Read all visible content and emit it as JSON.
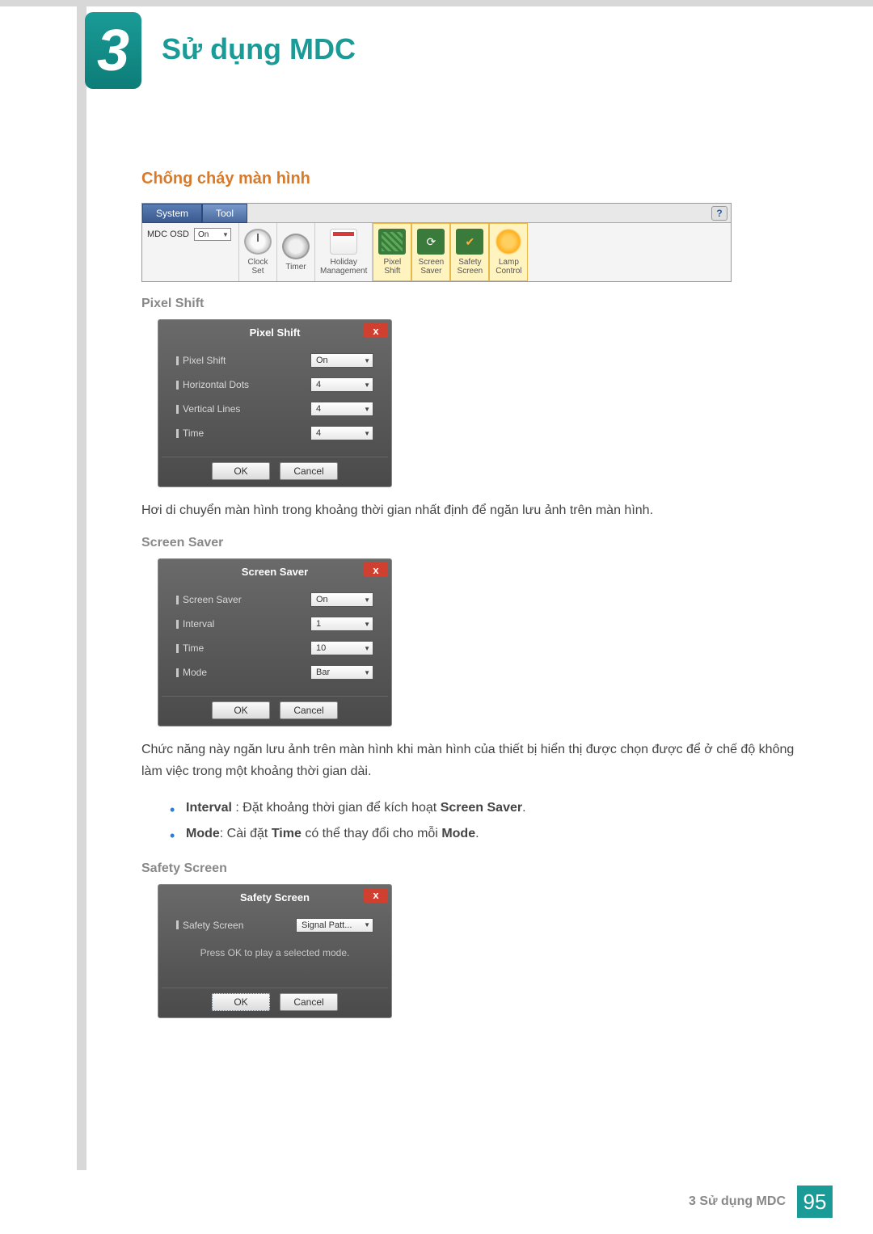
{
  "header": {
    "chapter_number": "3",
    "chapter_title": "Sử dụng MDC"
  },
  "section": {
    "title": "Chống cháy màn hình"
  },
  "toolbar": {
    "tabs": {
      "system": "System",
      "tool": "Tool"
    },
    "mdc_osd_label": "MDC OSD",
    "mdc_osd_value": "On",
    "help": "?",
    "items": {
      "clock_set": "Clock\nSet",
      "timer": "Timer",
      "holiday": "Holiday\nManagement",
      "pixel_shift": "Pixel\nShift",
      "screen_saver": "Screen\nSaver",
      "safety_screen": "Safety\nScreen",
      "lamp_control": "Lamp\nControl"
    }
  },
  "pixel_shift": {
    "heading": "Pixel Shift",
    "dialog_title": "Pixel Shift",
    "rows": {
      "pixel_shift": {
        "label": "Pixel Shift",
        "value": "On"
      },
      "horizontal_dots": {
        "label": "Horizontal Dots",
        "value": "4"
      },
      "vertical_lines": {
        "label": "Vertical Lines",
        "value": "4"
      },
      "time": {
        "label": "Time",
        "value": "4"
      }
    },
    "ok": "OK",
    "cancel": "Cancel",
    "description": "Hơi di chuyển màn hình trong khoảng thời gian nhất định để ngăn lưu ảnh trên màn hình."
  },
  "screen_saver": {
    "heading": "Screen Saver",
    "dialog_title": "Screen Saver",
    "rows": {
      "screen_saver": {
        "label": "Screen Saver",
        "value": "On"
      },
      "interval": {
        "label": "Interval",
        "value": "1"
      },
      "time": {
        "label": "Time",
        "value": "10"
      },
      "mode": {
        "label": "Mode",
        "value": "Bar"
      }
    },
    "ok": "OK",
    "cancel": "Cancel",
    "description": "Chức năng này ngăn lưu ảnh trên màn hình khi màn hình của thiết bị hiển thị được chọn được để ở chế độ không làm việc trong một khoảng thời gian dài.",
    "bullets": {
      "interval_b1": "Interval",
      "interval_txt": " : Đặt khoảng thời gian để kích hoạt ",
      "interval_b2": "Screen Saver",
      "interval_end": ".",
      "mode_b1": "Mode",
      "mode_txt1": ": Cài đặt ",
      "mode_b2": "Time",
      "mode_txt2": " có thể thay đổi cho mỗi ",
      "mode_b3": "Mode",
      "mode_end": "."
    }
  },
  "safety_screen": {
    "heading": "Safety Screen",
    "dialog_title": "Safety Screen",
    "row": {
      "label": "Safety Screen",
      "value": "Signal Patt..."
    },
    "message": "Press OK to play a selected mode.",
    "ok": "OK",
    "cancel": "Cancel"
  },
  "footer": {
    "text": "3 Sử dụng MDC",
    "page": "95"
  },
  "close_x": "x"
}
